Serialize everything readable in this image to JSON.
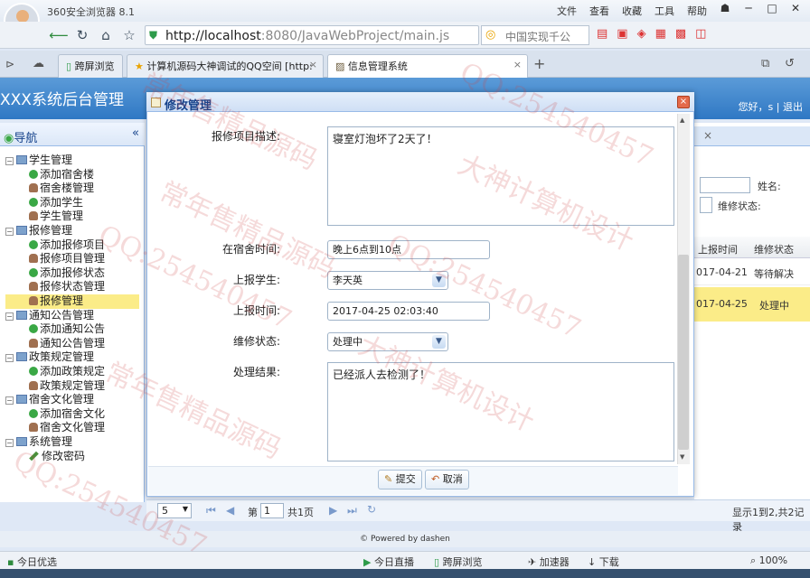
{
  "browser": {
    "app_title": "360安全浏览器 8.1",
    "menu": [
      "文件",
      "查看",
      "收藏",
      "工具",
      "帮助"
    ],
    "url_host": "http://localhost",
    "url_rest": ":8080/JavaWebProject/main.js",
    "search_text": "中国实现千公",
    "tabs": [
      "跨屏浏览",
      "计算机源码大神调试的QQ空间 [http:",
      "信息管理系统"
    ],
    "tab_close": "×",
    "new_tab": "+"
  },
  "app": {
    "system_title": "XXX系统后台管理",
    "greeting": "您好，s  |  退出"
  },
  "nav": {
    "title": "导航",
    "collapse_icon": "«",
    "items": [
      {
        "label": "学生管理",
        "level": 0
      },
      {
        "label": "添加宿舍楼",
        "level": 1,
        "icon": "add"
      },
      {
        "label": "宿舍楼管理",
        "level": 1,
        "icon": "user"
      },
      {
        "label": "添加学生",
        "level": 1,
        "icon": "add"
      },
      {
        "label": "学生管理",
        "level": 1,
        "icon": "user"
      },
      {
        "label": "报修管理",
        "level": 0
      },
      {
        "label": "添加报修项目",
        "level": 1,
        "icon": "add"
      },
      {
        "label": "报修项目管理",
        "level": 1,
        "icon": "user"
      },
      {
        "label": "添加报修状态",
        "level": 1,
        "icon": "add"
      },
      {
        "label": "报修状态管理",
        "level": 1,
        "icon": "user"
      },
      {
        "label": "报修管理",
        "level": 1,
        "icon": "user",
        "selected": true
      },
      {
        "label": "通知公告管理",
        "level": 0
      },
      {
        "label": "添加通知公告",
        "level": 1,
        "icon": "add"
      },
      {
        "label": "通知公告管理",
        "level": 1,
        "icon": "user"
      },
      {
        "label": "政策规定管理",
        "level": 0
      },
      {
        "label": "添加政策规定",
        "level": 1,
        "icon": "add"
      },
      {
        "label": "政策规定管理",
        "level": 1,
        "icon": "user"
      },
      {
        "label": "宿舍文化管理",
        "level": 0
      },
      {
        "label": "添加宿舍文化",
        "level": 1,
        "icon": "add"
      },
      {
        "label": "宿舍文化管理",
        "level": 1,
        "icon": "user"
      },
      {
        "label": "系统管理",
        "level": 0
      },
      {
        "label": "修改密码",
        "level": 1,
        "icon": "edit"
      }
    ]
  },
  "grid": {
    "search_name_label": "姓名:",
    "status_label": "维修状态:",
    "columns": [
      "上报时间",
      "维修状态"
    ],
    "rows": [
      {
        "time": "017-04-21",
        "status": "等待解决"
      },
      {
        "time": "017-04-25",
        "status": "处理中"
      }
    ],
    "pager": {
      "page_size": "5",
      "page_label": "第",
      "page": "1",
      "total": "共1页",
      "info": "显示1到2,共2记录"
    }
  },
  "footer": "© Powered by dashen",
  "dialog": {
    "title": "修改管理",
    "close_icon": "×",
    "fields": {
      "desc_label": "报修项目描述:",
      "desc_value": "寝室灯泡坏了2天了！",
      "time_in_label": "在宿舍时间:",
      "time_in_value": "晚上6点到10点",
      "student_label": "上报学生:",
      "student_value": "李天英",
      "report_time_label": "上报时间:",
      "report_time_value": "2017-04-25 02:03:40",
      "status_label": "维修状态:",
      "status_value": "处理中",
      "result_label": "处理结果:",
      "result_value": "已经派人去检测了！"
    },
    "submit": "提交",
    "cancel": "取消"
  },
  "statusbar": {
    "left": "今日优选",
    "items": [
      "今日直播",
      "跨屏浏览",
      "加速器",
      "下载"
    ],
    "zoom": "100%"
  },
  "watermarks": [
    "常年售精品源码",
    "QQ:254540457",
    "大神计算机设计"
  ]
}
